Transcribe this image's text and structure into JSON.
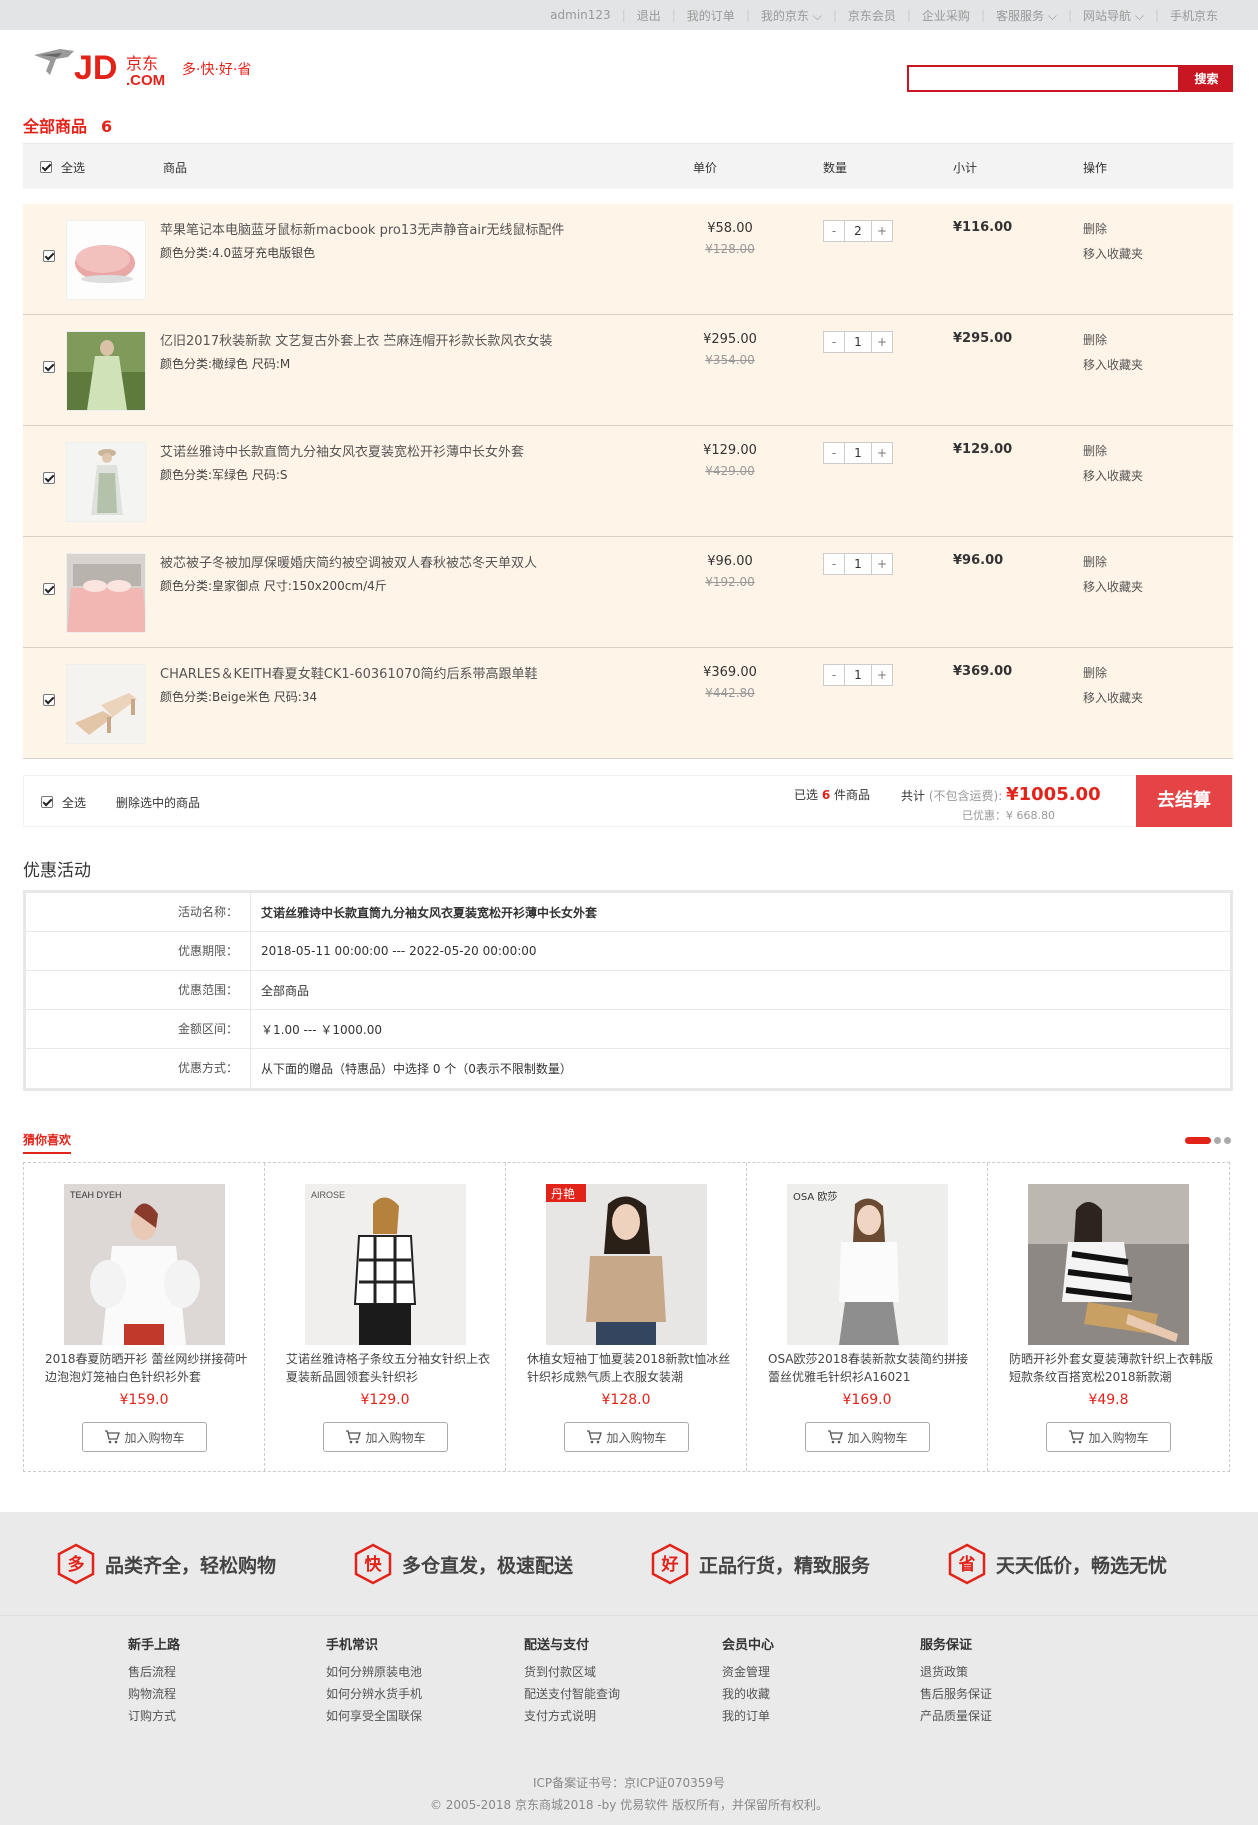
{
  "topbar": {
    "links": [
      {
        "label": "admin123"
      },
      {
        "label": "退出"
      },
      {
        "label": "我的订单"
      },
      {
        "label": "我的京东",
        "dropdown": true
      },
      {
        "label": "京东会员"
      },
      {
        "label": "企业采购"
      },
      {
        "label": "客服服务",
        "dropdown": true
      },
      {
        "label": "网站导航",
        "dropdown": true
      },
      {
        "label": "手机京东"
      }
    ]
  },
  "logo": {
    "brand": "JD",
    "brand_dot": ".COM",
    "brand_cn": "京东",
    "slogan": "多·快·好·省"
  },
  "search": {
    "placeholder": "",
    "value": "",
    "button": "搜索"
  },
  "cart": {
    "title": "全部商品",
    "count": "6",
    "headers": {
      "select_all": "全选",
      "product": "商品",
      "unit_price": "单价",
      "quantity": "数量",
      "subtotal": "小计",
      "action": "操作"
    },
    "items": [
      {
        "name": "苹果笔记本电脑蓝牙鼠标新macbook pro13无声静音air无线鼠标配件",
        "attr": "颜色分类:4.0蓝牙充电版银色",
        "price": "¥58.00",
        "old_price": "¥128.00",
        "qty": "2",
        "subtotal": "¥116.00",
        "del": "删除",
        "fav": "移入收藏夹"
      },
      {
        "name": "亿旧2017秋装新款 文艺复古外套上衣 苎麻连帽开衫款长款风衣女装",
        "attr": "颜色分类:橄绿色 尺码:M",
        "price": "¥295.00",
        "old_price": "¥354.00",
        "qty": "1",
        "subtotal": "¥295.00",
        "del": "删除",
        "fav": "移入收藏夹"
      },
      {
        "name": "艾诺丝雅诗中长款直筒九分袖女风衣夏装宽松开衫薄中长女外套",
        "attr": "颜色分类:军绿色 尺码:S",
        "price": "¥129.00",
        "old_price": "¥429.00",
        "qty": "1",
        "subtotal": "¥129.00",
        "del": "删除",
        "fav": "移入收藏夹"
      },
      {
        "name": "被芯被子冬被加厚保暖婚庆简约被空调被双人春秋被芯冬天单双人",
        "attr": "颜色分类:皇家御点 尺寸:150x200cm/4斤",
        "price": "¥96.00",
        "old_price": "¥192.00",
        "qty": "1",
        "subtotal": "¥96.00",
        "del": "删除",
        "fav": "移入收藏夹"
      },
      {
        "name": "CHARLES＆KEITH春夏女鞋CK1-60361070简约后系带高跟单鞋",
        "attr": "颜色分类:Beige米色 尺码:34",
        "price": "¥369.00",
        "old_price": "¥442.80",
        "qty": "1",
        "subtotal": "¥369.00",
        "del": "删除",
        "fav": "移入收藏夹"
      }
    ],
    "qty_minus": "-",
    "qty_plus": "+"
  },
  "summary": {
    "select_all": "全选",
    "delete_selected": "删除选中的商品",
    "selected_pre": "已选",
    "selected_count": "6",
    "selected_post": "件商品",
    "total_label": "共计",
    "total_note": "(不包含运费):",
    "total": "¥1005.00",
    "discount_label": "已优惠：",
    "discount": "¥ 668.80",
    "checkout": "去结算"
  },
  "promo": {
    "title": "优惠活动",
    "rows": [
      {
        "label": "活动名称：",
        "value": "艾诺丝雅诗中长款直筒九分袖女风衣夏装宽松开衫薄中长女外套",
        "bold": true
      },
      {
        "label": "优惠期限：",
        "value": "2018-05-11 00:00:00 --- 2022-05-20 00:00:00"
      },
      {
        "label": "优惠范围：",
        "value": "全部商品"
      },
      {
        "label": "金额区间：",
        "value": "￥1.00 --- ￥1000.00"
      },
      {
        "label": "优惠方式：",
        "value": "从下面的赠品（特惠品）中选择 0 个（0表示不限制数量）"
      }
    ]
  },
  "guess": {
    "title": "猜你喜欢",
    "add_label": "加入购物车",
    "items": [
      {
        "name": "2018春夏防晒开衫 蕾丝网纱拼接荷叶边泡泡灯笼袖白色针织衫外套",
        "price": "¥159.0",
        "brand_tag": "TEAH DYEH"
      },
      {
        "name": "艾诺丝雅诗格子条纹五分袖女针织上衣夏装新品圆领套头针织衫",
        "price": "¥129.0",
        "brand_tag": "AIROSE"
      },
      {
        "name": "休植女短袖丁恤夏装2018新款t恤冰丝针织衫成熟气质上衣服女装潮",
        "price": "¥128.0",
        "brand_tag": "丹艳"
      },
      {
        "name": "OSA欧莎2018春装新款女装简约拼接蕾丝优雅毛针织衫A16021",
        "price": "¥169.0",
        "brand_tag": "OSA 欧莎"
      },
      {
        "name": "防晒开衫外套女夏装薄款针织上衣韩版短款条纹百搭宽松2018新款潮",
        "price": "¥49.8",
        "brand_tag": ""
      }
    ]
  },
  "footer": {
    "slogans": [
      {
        "icon": "多",
        "text": "品类齐全，轻松购物"
      },
      {
        "icon": "快",
        "text": "多仓直发，极速配送"
      },
      {
        "icon": "好",
        "text": "正品行货，精致服务"
      },
      {
        "icon": "省",
        "text": "天天低价，畅选无忧"
      }
    ],
    "columns": [
      {
        "title": "新手上路",
        "links": [
          "售后流程",
          "购物流程",
          "订购方式"
        ]
      },
      {
        "title": "手机常识",
        "links": [
          "如何分辨原装电池",
          "如何分辨水货手机",
          "如何享受全国联保"
        ]
      },
      {
        "title": "配送与支付",
        "links": [
          "货到付款区域",
          "配送支付智能查询",
          "支付方式说明"
        ]
      },
      {
        "title": "会员中心",
        "links": [
          "资金管理",
          "我的收藏",
          "我的订单"
        ]
      },
      {
        "title": "服务保证",
        "links": [
          "退货政策",
          "售后服务保证",
          "产品质量保证"
        ]
      }
    ],
    "icp": "ICP备案证书号：京ICP证070359号",
    "copyright": "© 2005-2018 京东商城2018 -by 优易软件 版权所有，并保留所有权利。"
  },
  "colors": {
    "brand_red": "#e2231a",
    "search_red": "#c81623",
    "checkout_red": "#e54346",
    "row_bg": "#fff4e8"
  }
}
